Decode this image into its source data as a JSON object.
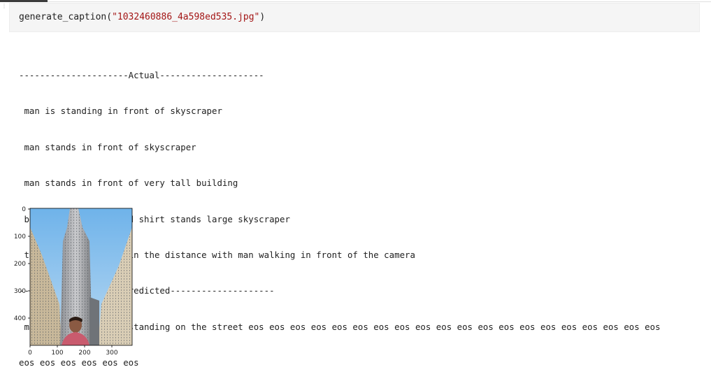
{
  "code": {
    "fn": "generate_caption",
    "open_paren": "(",
    "arg": "\"1032460886_4a598ed535.jpg\"",
    "close_paren": ")"
  },
  "output": {
    "actual_header": "---------------------Actual--------------------",
    "actual_captions": [
      " man is standing in front of skyscraper",
      " man stands in front of skyscraper",
      " man stands in front of very tall building",
      " behind the man in red shirt stands large skyscraper",
      " there is skyscraper in the distance with man walking in front of the camera"
    ],
    "predicted_header": "--------------------Predicted--------------------",
    "predicted_line_1": " man in black jacket standing on the street eos eos eos eos eos eos eos eos eos eos eos eos eos eos eos eos eos eos eos eos",
    "predicted_line_2": "eos eos eos eos eos eos"
  },
  "figure": {
    "y_ticks": [
      "0",
      "100",
      "200",
      "300",
      "400"
    ],
    "x_ticks": [
      "0",
      "100",
      "200",
      "300"
    ],
    "image_subject": "man in front of skyscraper"
  }
}
